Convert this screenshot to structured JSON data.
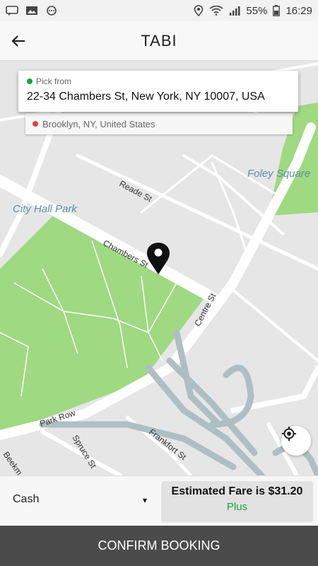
{
  "status_bar": {
    "battery": "55%",
    "time": "16:29",
    "left_icons": [
      "message-icon",
      "image-icon",
      "more-icon"
    ],
    "right_icons": [
      "location-icon",
      "wifi-icon",
      "signal-icon",
      "battery-icon"
    ]
  },
  "app_bar": {
    "title": "TABI",
    "back_icon": "arrow-left-icon"
  },
  "pickup": {
    "label": "Pick from",
    "address": "22-34 Chambers St, New York, NY 10007, USA",
    "dot_color": "#1aa33a"
  },
  "dropoff": {
    "address": "Brooklyn, NY, United States",
    "dot_color": "#e04040"
  },
  "map": {
    "labels": {
      "foley_square": "Foley Square",
      "city_hall_park": "City Hall Park",
      "reade_st": "Reade St",
      "chambers_st": "Chambers St",
      "centre_st": "Centre St",
      "park_row": "Park Row",
      "spruce_st": "Spruce St",
      "frankfort_st": "Frankfort St",
      "beekman": "Beekm"
    },
    "colors": {
      "park": "#9fd982",
      "road": "#ffffff",
      "ramp": "#aebfc4",
      "base": "#e6e6e6"
    },
    "marker_icon": "map-pin-icon",
    "locate_icon": "my-location-icon"
  },
  "booking": {
    "payment_method": "Cash",
    "dropdown_icon": "▾",
    "fare_text": "Estimated Fare is $31.20",
    "fare_tier": "Plus",
    "confirm_label": "CONFIRM BOOKING"
  }
}
